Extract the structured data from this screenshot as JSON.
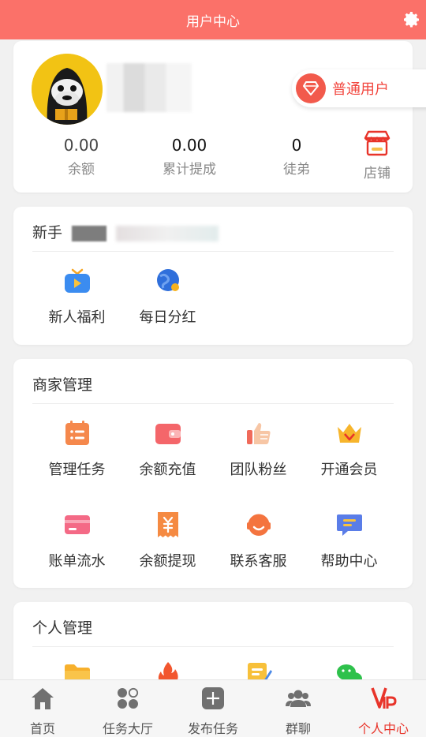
{
  "header": {
    "title": "用户中心",
    "settings_icon": "gear-icon"
  },
  "profile": {
    "user_level": "普通用户",
    "stats": [
      {
        "value": "0.00",
        "label": "余额"
      },
      {
        "value": "0.00",
        "label": "累计提成"
      },
      {
        "value": "0",
        "label": "徒弟"
      }
    ],
    "shop_label": "店铺"
  },
  "newbie": {
    "title": "新手",
    "items": [
      {
        "label": "新人福利",
        "icon": "tv-icon"
      },
      {
        "label": "每日分红",
        "icon": "globe-icon"
      }
    ]
  },
  "merchant": {
    "title": "商家管理",
    "items": [
      {
        "label": "管理任务",
        "icon": "calendar-list-icon"
      },
      {
        "label": "余额充值",
        "icon": "wallet-icon"
      },
      {
        "label": "团队粉丝",
        "icon": "thumbs-up-icon"
      },
      {
        "label": "开通会员",
        "icon": "crown-icon"
      },
      {
        "label": "账单流水",
        "icon": "card-icon"
      },
      {
        "label": "余额提现",
        "icon": "receipt-yuan-icon"
      },
      {
        "label": "联系客服",
        "icon": "headset-icon"
      },
      {
        "label": "帮助中心",
        "icon": "chat-bubble-icon"
      }
    ]
  },
  "personal": {
    "title": "个人管理",
    "items": [
      {
        "icon": "folder-icon"
      },
      {
        "icon": "fire-icon"
      },
      {
        "icon": "notepad-icon"
      },
      {
        "icon": "wechat-icon"
      }
    ]
  },
  "tabbar": {
    "items": [
      {
        "label": "首页",
        "icon": "home-icon"
      },
      {
        "label": "任务大厅",
        "icon": "apps-icon"
      },
      {
        "label": "发布任务",
        "icon": "plus-square-icon"
      },
      {
        "label": "群聊",
        "icon": "group-icon"
      },
      {
        "label": "个人中心",
        "icon": "vip-icon",
        "active": true
      }
    ]
  },
  "colors": {
    "brand": "#fb7169",
    "accent_red": "#e8342a",
    "avatar_yellow": "#f2c314"
  }
}
